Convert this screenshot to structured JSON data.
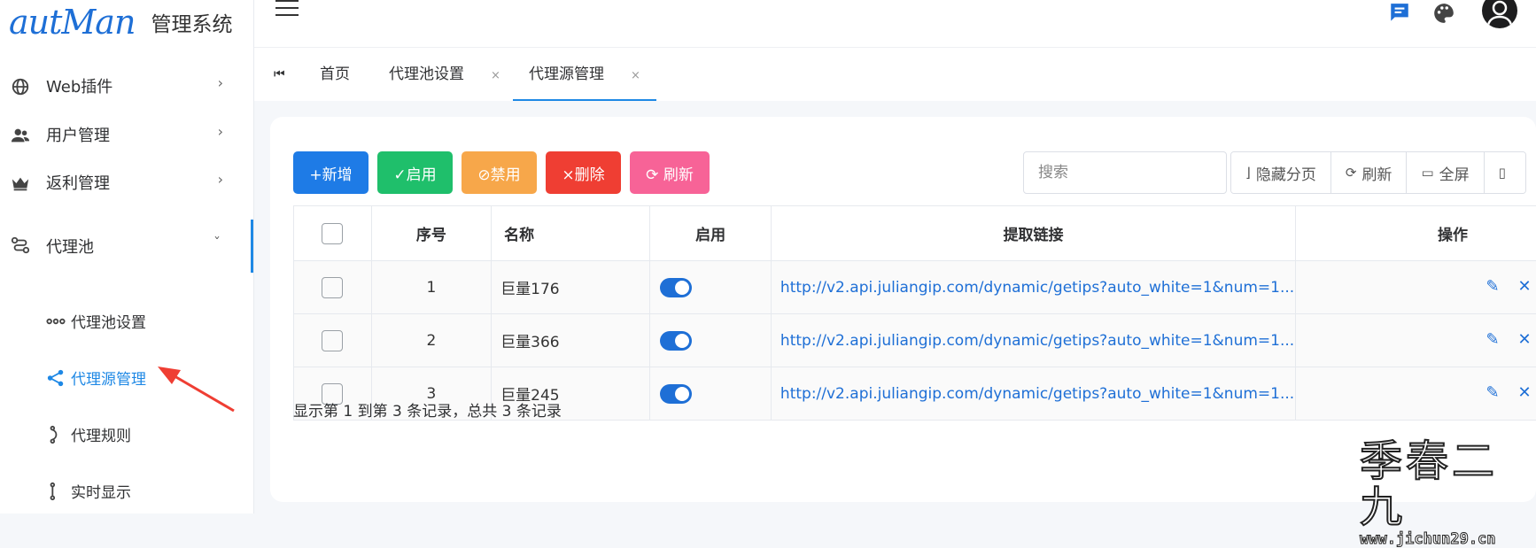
{
  "app": {
    "logo_script": "autMan",
    "title": "管理系统"
  },
  "sidebar": {
    "items": [
      {
        "label": "Web插件",
        "arrow": "›"
      },
      {
        "label": "用户管理",
        "arrow": "›"
      },
      {
        "label": "返利管理",
        "arrow": "›"
      },
      {
        "label": "代理池",
        "arrow": "ˇ"
      }
    ],
    "sub_items": [
      {
        "label": "代理池设置"
      },
      {
        "label": "代理源管理"
      },
      {
        "label": "代理规则"
      },
      {
        "label": "实时显示"
      }
    ]
  },
  "tabs": [
    {
      "label": "首页"
    },
    {
      "label": "代理池设置",
      "close": "×"
    },
    {
      "label": "代理源管理",
      "close": "×"
    }
  ],
  "toolbar": {
    "add": "+新增",
    "enable": "✓启用",
    "disable": "⊘禁用",
    "delete": "×删除",
    "refresh": "⟳ 刷新",
    "search_placeholder": "搜索",
    "hide_page": "隐藏分页",
    "refresh2": "刷新",
    "fullscreen": "全屏"
  },
  "table": {
    "headers": {
      "index": "序号",
      "name": "名称",
      "enabled": "启用",
      "link": "提取链接",
      "actions": "操作"
    },
    "rows": [
      {
        "index": "1",
        "name": "巨量176",
        "enabled": true,
        "link": "http://v2.api.juliangip.com/dynamic/getips?auto_white=1&num=1..."
      },
      {
        "index": "2",
        "name": "巨量366",
        "enabled": true,
        "link": "http://v2.api.juliangip.com/dynamic/getips?auto_white=1&num=1..."
      },
      {
        "index": "3",
        "name": "巨量245",
        "enabled": true,
        "link": "http://v2.api.juliangip.com/dynamic/getips?auto_white=1&num=1..."
      }
    ]
  },
  "footer": {
    "records": "显示第 1 到第 3 条记录，总共 3 条记录"
  },
  "watermark": {
    "big": "季春二九",
    "small": "www.jichun29.cn"
  },
  "colors": {
    "primary": "#1e6fd6",
    "success": "#1fbf6b",
    "warning": "#f7a74a",
    "danger": "#ef3e33",
    "pink": "#f76397",
    "blue_btn": "#1e88e5"
  }
}
